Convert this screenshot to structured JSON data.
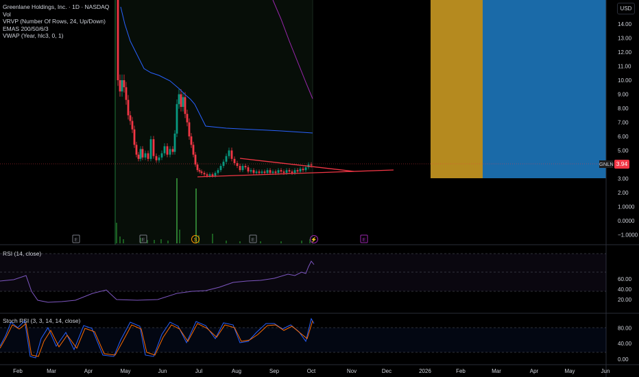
{
  "header": {
    "title": "Greenlane Holdings, Inc. · 1D · NASDAQ",
    "indicators": [
      "Vol",
      "VRVP (Number Of Rows, 24, Up/Down)",
      "EMAS 200/50/6/3",
      "VWAP (Year, hlc3, 0, 1)"
    ]
  },
  "currency": "USD",
  "symbol_tag": "GNLN",
  "last_price": "3.94",
  "price_axis": {
    "labels": [
      "14.00",
      "13.00",
      "12.00",
      "11.00",
      "10.00",
      "9.00",
      "8.00",
      "7.00",
      "6.00",
      "5.00",
      "4.00",
      "3.00",
      "2.00",
      "1.0000",
      "0.0000",
      "−1.0000"
    ],
    "values": [
      14,
      13,
      12,
      11,
      10,
      9,
      8,
      7,
      6,
      5,
      4,
      3,
      2,
      1,
      0,
      -1
    ]
  },
  "event_markers": [
    {
      "symbol": "E",
      "type": "earnings",
      "date": "Mar"
    },
    {
      "symbol": "E",
      "type": "earnings",
      "date": "May"
    },
    {
      "symbol": "S",
      "type": "split",
      "date": "Jul"
    },
    {
      "symbol": "E",
      "type": "earnings",
      "date": "Aug"
    },
    {
      "symbol": "⚡",
      "type": "news",
      "date": "Oct"
    },
    {
      "symbol": "E",
      "type": "earnings-upcoming",
      "date": "Nov"
    }
  ],
  "rsi": {
    "label": "RSI (14, close)",
    "axis_labels": [
      "60.00",
      "40.00",
      "20.00"
    ],
    "axis_values": [
      60,
      40,
      20
    ]
  },
  "stoch": {
    "label": "Stoch RSI (3, 3, 14, 14, close)",
    "axis_labels": [
      "80.00",
      "40.00",
      "0.00"
    ],
    "axis_values": [
      80,
      40,
      0
    ]
  },
  "time_axis": [
    "Feb",
    "Mar",
    "Apr",
    "May",
    "Jun",
    "Jul",
    "Aug",
    "Sep",
    "Oct",
    "Nov",
    "Dec",
    "2026",
    "Feb",
    "Mar",
    "Apr",
    "May",
    "Jun"
  ],
  "colors": {
    "up": "#089981",
    "down": "#f23645",
    "ema_blue": "#2962ff",
    "ema_purple": "#9c27b0",
    "trendline": "#f23645",
    "rsi": "#7e57c2",
    "stoch_k": "#2962ff",
    "stoch_d": "#ff6d00",
    "target_gold": "#b58a1f",
    "target_blue": "#1a6aa8",
    "volume_up": "#2e7d32",
    "volume_down": "#b71c1c"
  }
}
